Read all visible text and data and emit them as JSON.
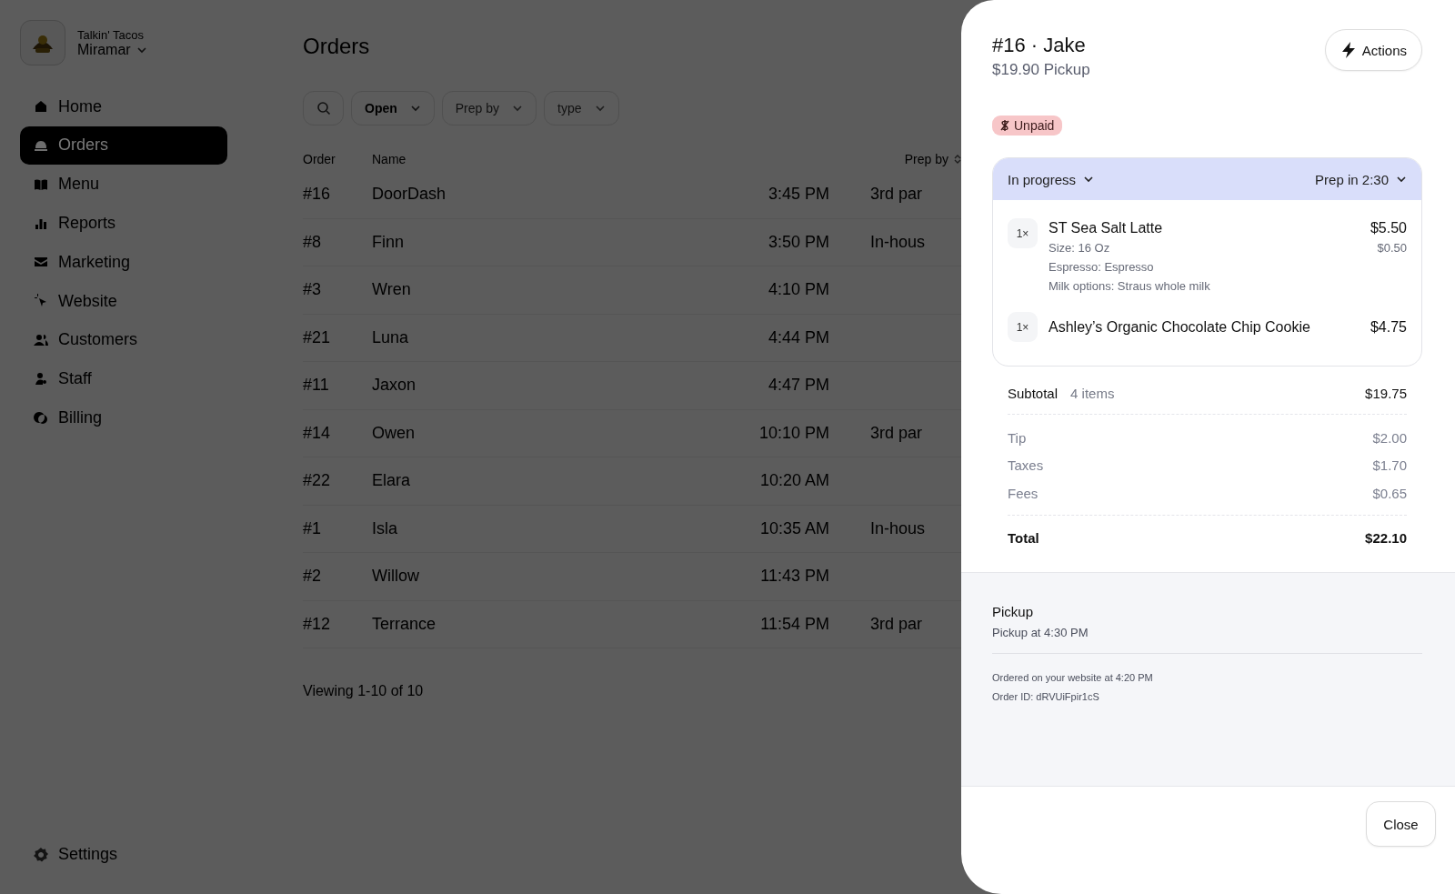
{
  "sidebar": {
    "brand": "Talkin' Tacos",
    "location": "Miramar",
    "items": [
      {
        "label": "Home",
        "selected": false
      },
      {
        "label": "Orders",
        "selected": true
      },
      {
        "label": "Menu",
        "selected": false
      },
      {
        "label": "Reports",
        "selected": false
      },
      {
        "label": "Marketing",
        "selected": false
      },
      {
        "label": "Website",
        "selected": false
      },
      {
        "label": "Customers",
        "selected": false
      },
      {
        "label": "Staff",
        "selected": false
      },
      {
        "label": "Billing",
        "selected": false
      }
    ],
    "footer_item": {
      "label": "Settings"
    }
  },
  "main": {
    "title": "Orders",
    "filters": [
      {
        "label": "Open",
        "active": true
      },
      {
        "label": "Prep by",
        "active": false
      },
      {
        "label": "type",
        "active": false
      }
    ],
    "table": {
      "columns": [
        "Order",
        "Name",
        "Prep by"
      ],
      "rows": [
        {
          "order": "#16",
          "name": "DoorDash",
          "prep_by": "3:45 PM",
          "column_4": "3rd par"
        },
        {
          "order": "#8",
          "name": "Finn",
          "prep_by": "3:50 PM",
          "column_4": "In-hous"
        },
        {
          "order": "#3",
          "name": "Wren",
          "prep_by": "4:10 PM"
        },
        {
          "order": "#21",
          "name": "Luna",
          "prep_by": "4:44 PM"
        },
        {
          "order": "#11",
          "name": "Jaxon",
          "prep_by": "4:47 PM"
        },
        {
          "order": "#14",
          "name": "Owen",
          "prep_by": "10:10 PM",
          "column_4": "3rd par"
        },
        {
          "order": "#22",
          "name": "Elara",
          "prep_by": "10:20 AM"
        },
        {
          "order": "#1",
          "name": "Isla",
          "prep_by": "10:35 AM",
          "column_4": "In-hous"
        },
        {
          "order": "#2",
          "name": "Willow",
          "prep_by": "11:43 PM"
        },
        {
          "order": "#12",
          "name": "Terrance",
          "prep_by": "11:54 PM",
          "column_4": "3rd par"
        }
      ]
    },
    "pagination": "Viewing 1-10 of 10"
  },
  "order_panel": {
    "title": "#16 · Jake",
    "subtitle": "$19.90 Pickup",
    "actions_button": "Actions",
    "badge": "Unpaid",
    "status": "In progress",
    "prep_time": "Prep in 2:30",
    "items": [
      {
        "qty": "1×",
        "name": "ST Sea Salt Latte",
        "price": "$5.50",
        "modifiers": [
          {
            "text": "Size: 16 Oz",
            "price": "$0.50"
          },
          {
            "text": "Espresso: Espresso"
          },
          {
            "text": "Milk options: Straus whole milk"
          }
        ]
      },
      {
        "qty": "1×",
        "name": "Ashley’s Organic Chocolate Chip Cookie",
        "price": "$4.75"
      }
    ],
    "subtotal": {
      "label": "Subtotal",
      "count": "4 items",
      "amount": "$19.75"
    },
    "charges": [
      {
        "label": "Tip",
        "amount": "$2.00"
      },
      {
        "label": "Taxes",
        "amount": "$1.70"
      },
      {
        "label": "Fees",
        "amount": "$0.65"
      }
    ],
    "total": {
      "label": "Total",
      "amount": "$22.10"
    },
    "fulfillment": {
      "heading": "Pickup",
      "detail": "Pickup at 4:30 PM",
      "meta": [
        "Ordered on your website at 4:20 PM",
        "Order ID: dRVUiFpir1cS"
      ]
    },
    "close_button": "Close"
  }
}
